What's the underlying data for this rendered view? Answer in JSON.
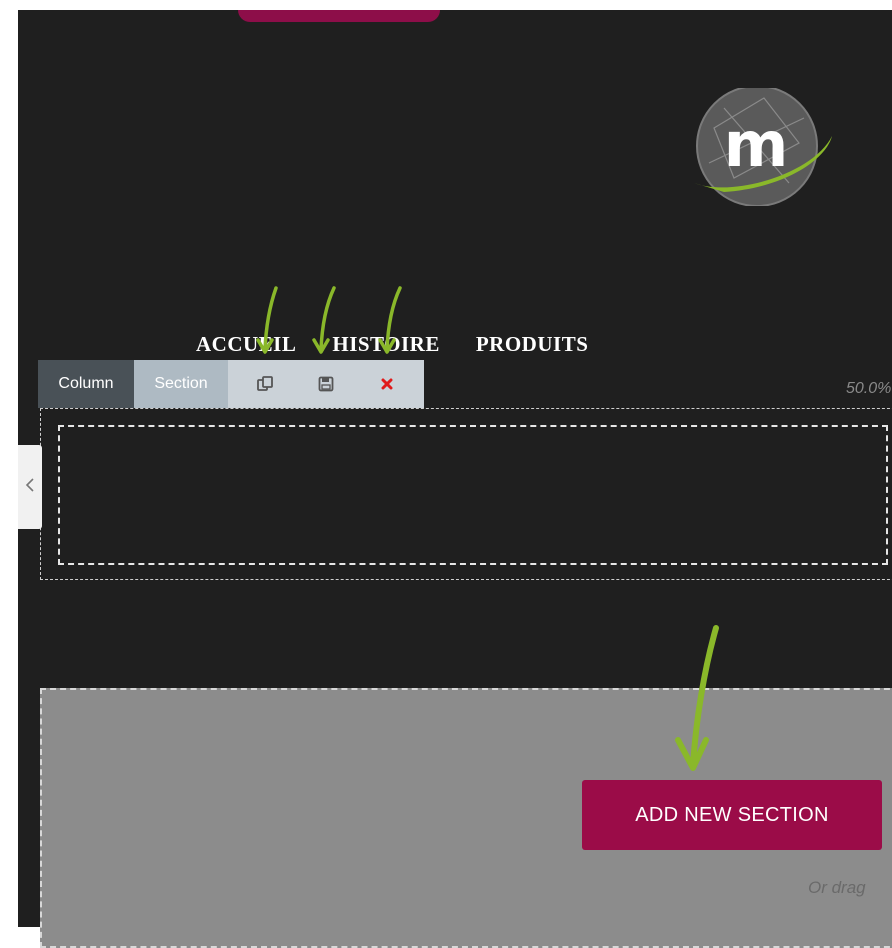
{
  "nav": {
    "items": [
      {
        "label": "ACCUEIL"
      },
      {
        "label": "HISTOIRE"
      },
      {
        "label": "PRODUITS"
      }
    ]
  },
  "toolbar": {
    "column_label": "Column",
    "section_label": "Section",
    "icons": [
      "duplicate-icon",
      "save-icon",
      "delete-icon"
    ]
  },
  "column_width_text": "50.0%",
  "add_section": {
    "button_label": "ADD NEW SECTION",
    "hint_text": "Or drag"
  },
  "colors": {
    "canvas_bg": "#1f1f1f",
    "brand": "#9b0c48",
    "logo_green": "#8ab82a",
    "arrow_green": "#8ab82a"
  }
}
